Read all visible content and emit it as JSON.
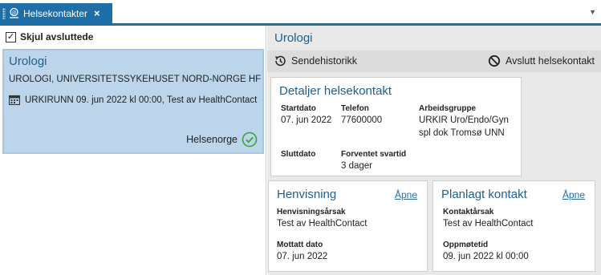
{
  "tab": {
    "label": "Helsekontakter",
    "close": "×",
    "menu": "▼"
  },
  "left": {
    "filter_label": "Skjul avsluttede",
    "filter_checked": "✓",
    "item": {
      "title": "Urologi",
      "org": "UROLOGI, UNIVERSITETSSYKEHUSET NORD-NORGE HF",
      "appointment": "URKIRUNN 09. jun 2022 kl 00:00, Test av HealthContact",
      "channel": "Helsenorge"
    }
  },
  "right": {
    "title": "Urologi",
    "toolbar": {
      "history": "Sendehistorikk",
      "end": "Avslutt helsekontakt"
    },
    "details": {
      "title": "Detaljer helsekontakt",
      "start_label": "Startdato",
      "start_value": "07. jun 2022",
      "phone_label": "Telefon",
      "phone_value": "77600000",
      "group_label": "Arbeidsgruppe",
      "group_value_1": "URKIR Uro/Endo/Gyn",
      "group_value_2": "spl dok Tromsø UNN",
      "end_label": "Sluttdato",
      "expected_label": "Forventet svartid",
      "expected_value": "3 dager"
    },
    "referral": {
      "title": "Henvisning",
      "open": "Åpne",
      "reason_label": "Henvisningsårsak",
      "reason_value": "Test av HealthContact",
      "received_label": "Mottatt dato",
      "received_value": "07. jun 2022"
    },
    "planned": {
      "title": "Planlagt kontakt",
      "open": "Åpne",
      "reason_label": "Kontaktårsak",
      "reason_value": "Test av HealthContact",
      "time_label": "Oppmøtetid",
      "time_value": "09. jun 2022 kl 00:00"
    }
  },
  "colors": {
    "accent": "#1e6fa8",
    "selected": "#bcd5ea",
    "ok": "#3aa53a"
  }
}
